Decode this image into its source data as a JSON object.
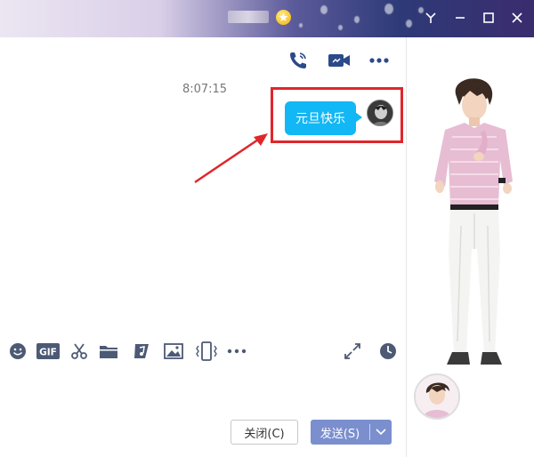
{
  "window": {
    "title_blurred": "",
    "controls": [
      "menu-chevron-icon",
      "minimize-icon",
      "maximize-icon",
      "close-icon"
    ]
  },
  "header": {
    "actions": [
      "voice-call-icon",
      "video-call-icon",
      "more-icon"
    ]
  },
  "chat": {
    "timestamp": "8:07:15",
    "messages": [
      {
        "from": "me",
        "text": "元旦快乐"
      }
    ]
  },
  "toolbar": {
    "gif_label": "GIF",
    "icons": [
      "emoji-icon",
      "gif-icon",
      "scissors-icon",
      "folder-icon",
      "music-icon",
      "image-icon",
      "shake-icon",
      "more-icon",
      "expand-icon",
      "history-clock-icon"
    ]
  },
  "buttons": {
    "close_label": "关闭(C)",
    "send_label": "发送(S)"
  },
  "colors": {
    "bubble": "#12b7f5",
    "send_button": "#7b8fcf",
    "highlight": "#e0262c",
    "icon": "#2b4a8a"
  }
}
